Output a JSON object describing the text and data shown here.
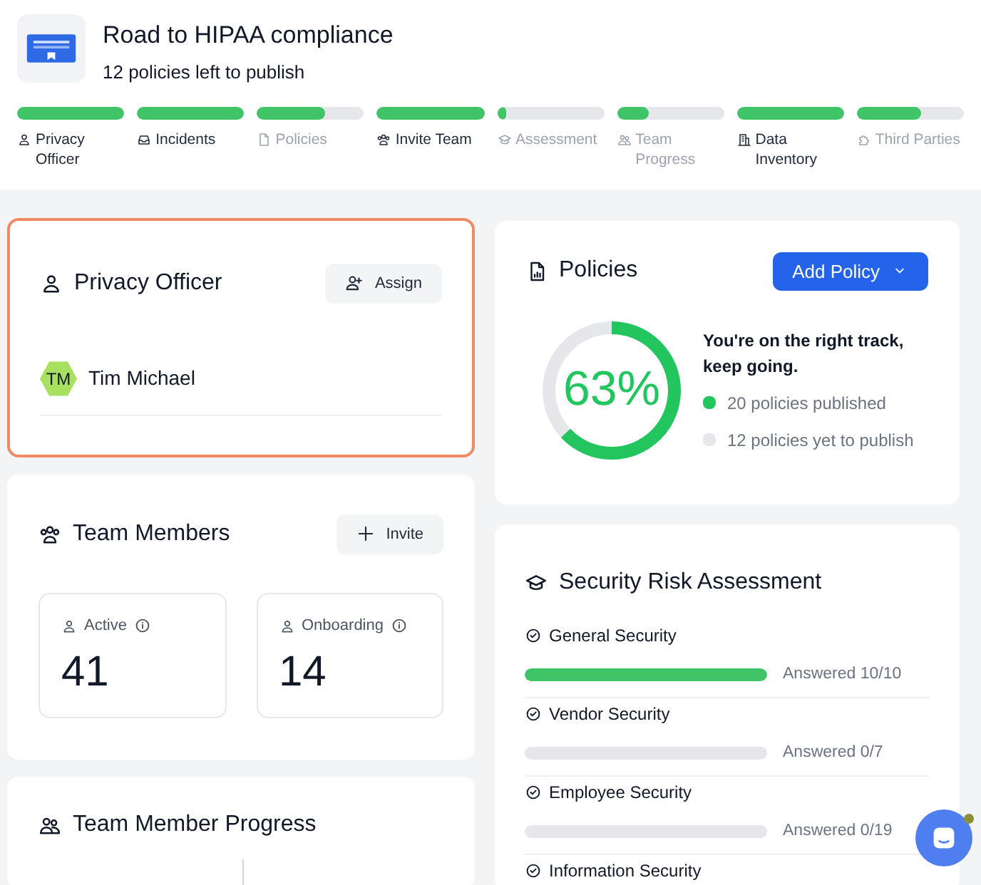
{
  "header": {
    "title": "Road to HIPAA compliance",
    "subtitle": "12 policies left to publish"
  },
  "steps": [
    {
      "label": "Privacy Officer",
      "level": 1,
      "done": true
    },
    {
      "label": "Incidents",
      "level": 1,
      "done": true
    },
    {
      "label": "Policies",
      "level": 0.63,
      "done": false
    },
    {
      "label": "Invite Team",
      "level": 1,
      "done": true
    },
    {
      "label": "Assessment",
      "level": 0.08,
      "done": false
    },
    {
      "label": "Team Progress",
      "level": 0.3,
      "done": false
    },
    {
      "label": "Data Inventory",
      "level": 1,
      "done": true
    },
    {
      "label": "Third Parties",
      "level": 0.6,
      "done": false
    }
  ],
  "privacy_officer": {
    "title": "Privacy Officer",
    "selected": true,
    "button": "Assign",
    "member": {
      "initials": "TM",
      "name": "Tim Michael"
    }
  },
  "team_members": {
    "title": "Team Members",
    "button": "Invite",
    "stats": [
      {
        "label": "Active",
        "value": "41"
      },
      {
        "label": "Onboarding",
        "value": "14"
      }
    ]
  },
  "team_member_progress": {
    "title": "Team Member Progress"
  },
  "policies": {
    "title": "Policies",
    "button": "Add Policy",
    "level": 0.63,
    "percent": "63%",
    "message": "You're on the right track, keep going.",
    "legend": [
      {
        "label": "20 policies published",
        "color": "#22c55e"
      },
      {
        "label": "12 policies yet to publish",
        "color": "#e5e7eb"
      }
    ]
  },
  "security_risk_assessment": {
    "title": "Security Risk Assessment",
    "sections": [
      {
        "name": "General Security",
        "level": 1,
        "reading": "Answered 10/10"
      },
      {
        "name": "Vendor Security",
        "reading": "Answered 0/7"
      },
      {
        "name": "Employee Security",
        "reading": "Answered 0/19"
      },
      {
        "name": "Information Security"
      }
    ]
  },
  "chat": {
    "unread": true
  }
}
